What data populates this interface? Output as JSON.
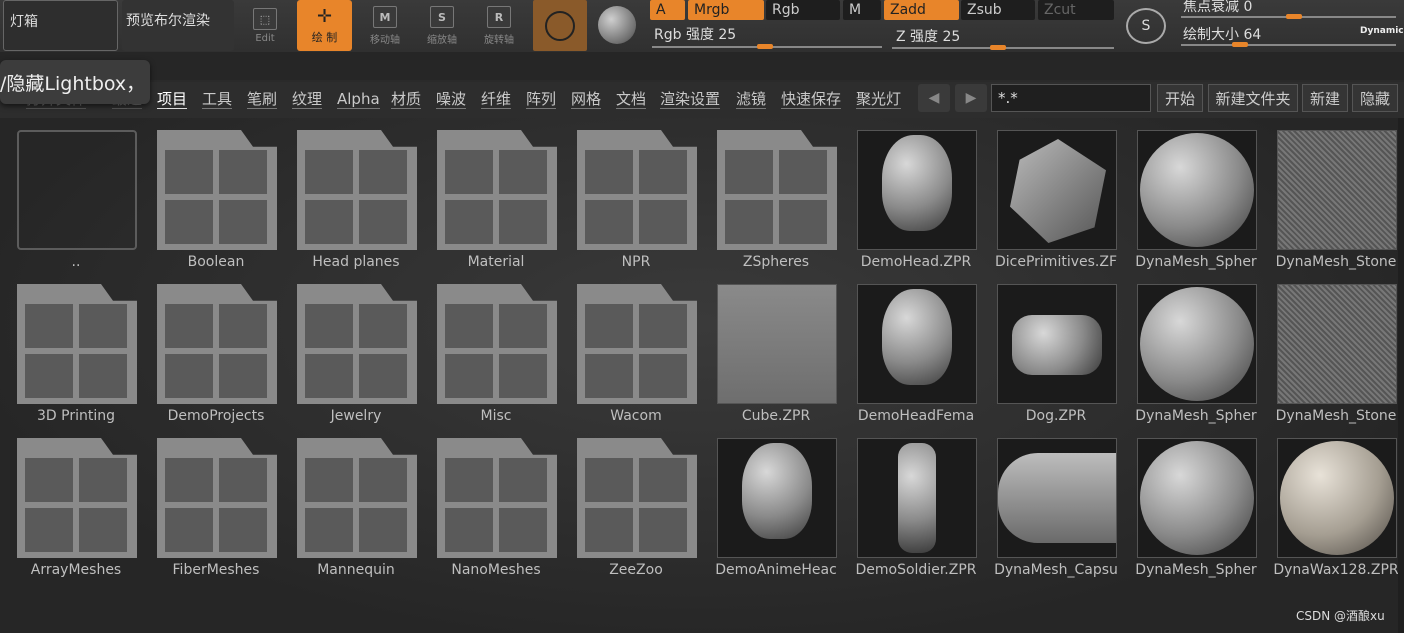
{
  "topbar": {
    "lightbox": "灯箱",
    "preview_bool": "预览布尔渲染",
    "edit": "Edit",
    "draw": "绘 制",
    "move": "移动轴",
    "scale": "缩放轴",
    "rotate": "旋转轴",
    "move_icon": "M",
    "scale_icon": "S",
    "rotate_icon": "R",
    "a": "A",
    "mrgb": "Mrgb",
    "rgb": "Rgb",
    "m": "M",
    "zadd": "Zadd",
    "zsub": "Zsub",
    "zcut": "Zcut",
    "rgb_intensity": "Rgb 强度 25",
    "z_intensity": "Z 强度 25",
    "focal_shift": "焦点衰减 0",
    "draw_size": "绘制大小 64",
    "dynamic": "Dynamic",
    "brush_icon_letter": "S"
  },
  "tooltip": "/隐藏Lightbox，",
  "tabs": [
    "打开文件",
    "最近",
    "项目",
    "工具",
    "笔刷",
    "纹理",
    "Alpha",
    "材质",
    "噪波",
    "纤维",
    "阵列",
    "网格",
    "文档",
    "渲染设置",
    "滤镜",
    "快速保存",
    "聚光灯"
  ],
  "nav": {
    "back": "◀",
    "forward": "▶"
  },
  "search": {
    "value": "*.*"
  },
  "actions": [
    "开始",
    "新建文件夹",
    "新建",
    "隐藏"
  ],
  "items": [
    {
      "label": "..",
      "kind": "empty"
    },
    {
      "label": "Boolean",
      "kind": "folder"
    },
    {
      "label": "Head planes",
      "kind": "folder"
    },
    {
      "label": "Material",
      "kind": "folder"
    },
    {
      "label": "NPR",
      "kind": "folder"
    },
    {
      "label": "ZSpheres",
      "kind": "folder"
    },
    {
      "label": "DemoHead.ZPR",
      "kind": "head"
    },
    {
      "label": "DicePrimitives.ZF",
      "kind": "dice"
    },
    {
      "label": "DynaMesh_Spher",
      "kind": "sphere"
    },
    {
      "label": "DynaMesh_Stone",
      "kind": "stone"
    },
    {
      "label": "3D Printing",
      "kind": "folder"
    },
    {
      "label": "DemoProjects",
      "kind": "folder"
    },
    {
      "label": "Jewelry",
      "kind": "folder"
    },
    {
      "label": "Misc",
      "kind": "folder"
    },
    {
      "label": "Wacom",
      "kind": "folder"
    },
    {
      "label": "Cube.ZPR",
      "kind": "cube"
    },
    {
      "label": "DemoHeadFema",
      "kind": "head"
    },
    {
      "label": "Dog.ZPR",
      "kind": "dog"
    },
    {
      "label": "DynaMesh_Spher",
      "kind": "sphere"
    },
    {
      "label": "DynaMesh_Stone",
      "kind": "stone"
    },
    {
      "label": "ArrayMeshes",
      "kind": "folder"
    },
    {
      "label": "FiberMeshes",
      "kind": "folder"
    },
    {
      "label": "Mannequin",
      "kind": "folder"
    },
    {
      "label": "NanoMeshes",
      "kind": "folder"
    },
    {
      "label": "ZeeZoo",
      "kind": "folder"
    },
    {
      "label": "DemoAnimeHeac",
      "kind": "anime"
    },
    {
      "label": "DemoSoldier.ZPR",
      "kind": "soldier"
    },
    {
      "label": "DynaMesh_Capsu",
      "kind": "capsule"
    },
    {
      "label": "DynaMesh_Spher",
      "kind": "sphere"
    },
    {
      "label": "DynaWax128.ZPR",
      "kind": "wax"
    }
  ],
  "watermark": "CSDN @酒酿xu"
}
